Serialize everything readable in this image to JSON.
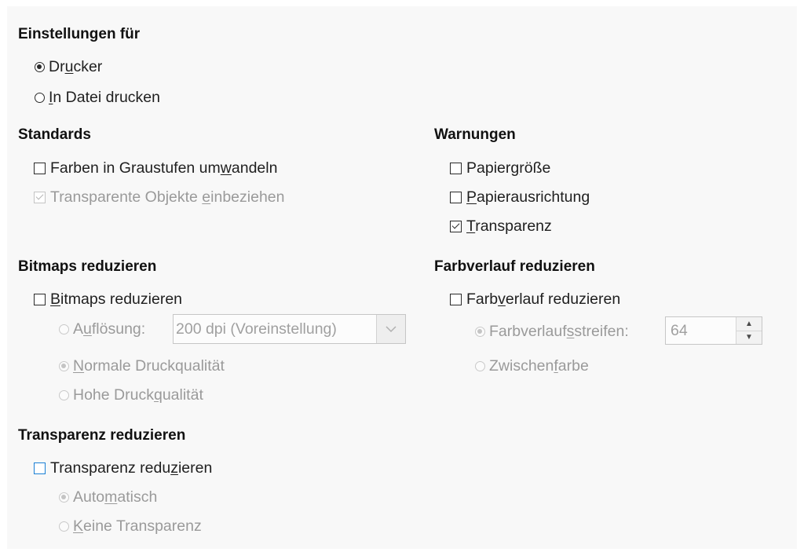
{
  "settings_for": {
    "heading": "Einstellungen für",
    "printer": {
      "pre": "Dr",
      "key": "u",
      "post": "cker"
    },
    "print_to_file": {
      "pre": "",
      "key": "I",
      "post": "n Datei drucken"
    }
  },
  "defaults": {
    "heading": "Standards",
    "grayscale": {
      "pre": "Farben in Graustufen um",
      "key": "w",
      "post": "andeln"
    },
    "include_transparent": {
      "pre": "Transparente Objekte ",
      "key": "e",
      "post": "inbeziehen"
    }
  },
  "warnings": {
    "heading": "Warnungen",
    "paper_size": {
      "pre": "Papier",
      "key": "g",
      "post": "röße"
    },
    "paper_orientation": {
      "pre": "",
      "key": "P",
      "post": "apierausrichtung"
    },
    "transparency": {
      "pre": "",
      "key": "T",
      "post": "ransparenz"
    }
  },
  "reduce_bitmaps": {
    "heading": "Bitmaps reduzieren",
    "checkbox": {
      "pre": "",
      "key": "B",
      "post": "itmaps reduzieren"
    },
    "resolution": {
      "pre": "A",
      "key": "u",
      "post": "flösung:"
    },
    "resolution_value": "200 dpi (Voreinstellung)",
    "normal_quality": {
      "pre": "",
      "key": "N",
      "post": "ormale Druckqualität"
    },
    "high_quality": {
      "pre": "Hohe Druck",
      "key": "q",
      "post": "ualität"
    }
  },
  "reduce_gradient": {
    "heading": "Farbverlauf reduzieren",
    "checkbox": {
      "pre": "Farb",
      "key": "v",
      "post": "erlauf reduzieren"
    },
    "stripes": {
      "pre": "Farbverlauf",
      "key": "s",
      "post": "streifen:"
    },
    "stripes_value": "64",
    "intermediate": {
      "pre": "Zwischen",
      "key": "f",
      "post": "arbe"
    }
  },
  "reduce_transparency": {
    "heading": "Transparenz reduzieren",
    "checkbox": {
      "pre": "Transparenz redu",
      "key": "z",
      "post": "ieren"
    },
    "automatic": {
      "pre": "Auto",
      "key": "m",
      "post": "atisch"
    },
    "none": {
      "pre": "",
      "key": "K",
      "post": "eine Transparenz"
    }
  },
  "state": {
    "printer_selected": true,
    "grayscale_checked": false,
    "include_transparent_checked": true,
    "paper_size_checked": false,
    "paper_orientation_checked": false,
    "transparency_warning_checked": true,
    "reduce_bitmaps_checked": false,
    "bitmap_mode": "normal",
    "reduce_gradient_checked": false,
    "gradient_mode": "stripes",
    "reduce_transparency_checked": false,
    "transparency_mode": "automatic"
  },
  "colors": {
    "panel_bg": "#f8f8f8",
    "disabled_text": "#9a9a9a",
    "focus_border": "#1a7fd4"
  }
}
